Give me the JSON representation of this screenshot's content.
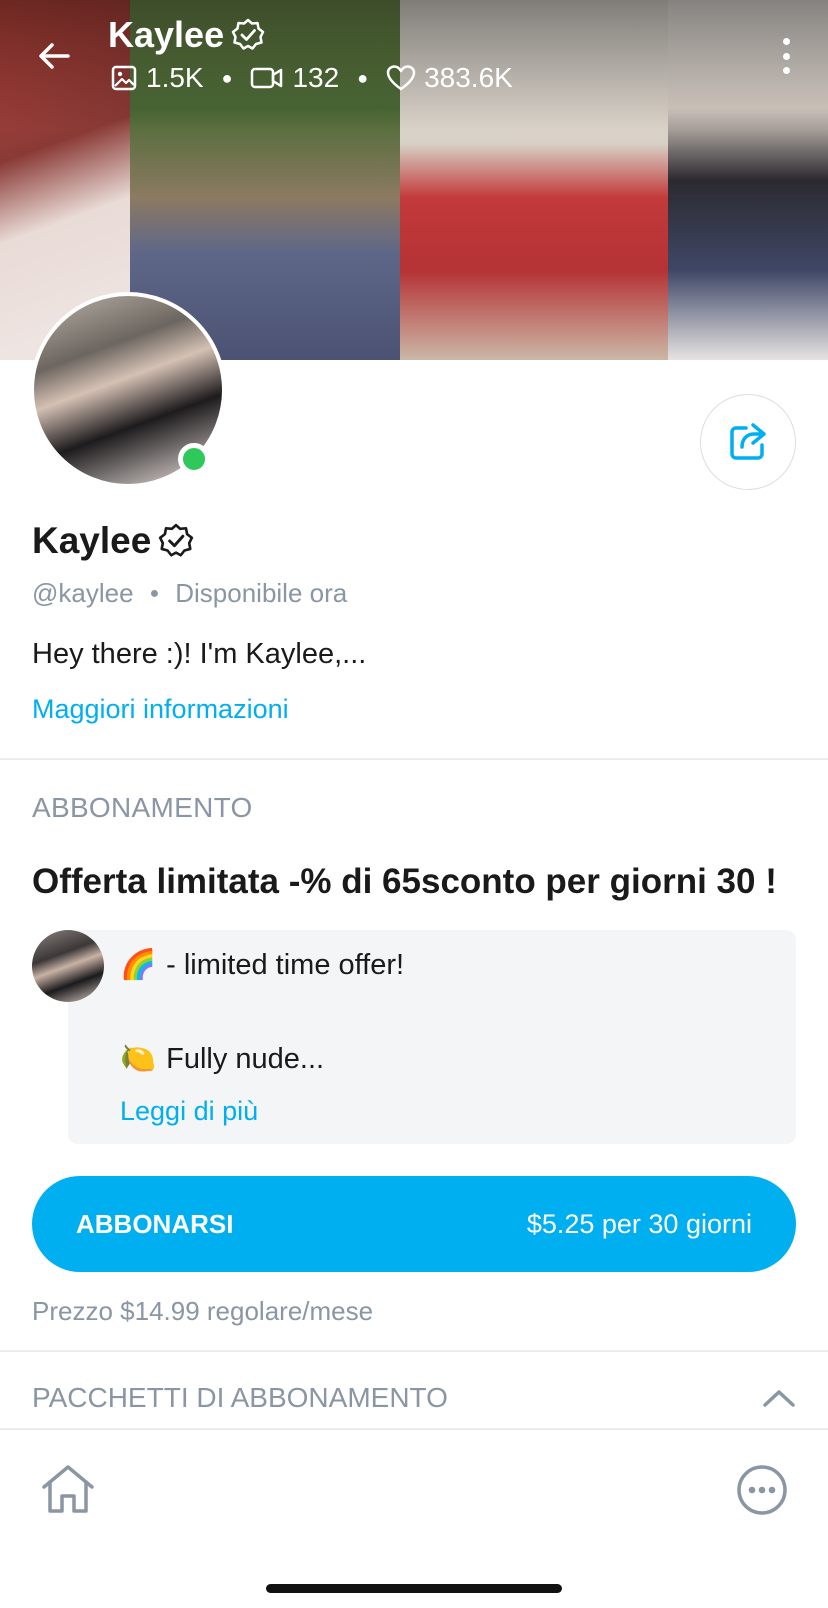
{
  "header": {
    "name": "Kaylee",
    "stats": {
      "photos": "1.5K",
      "videos": "132",
      "likes": "383.6K"
    }
  },
  "profile": {
    "name": "Kaylee",
    "handle": "@kaylee",
    "status": "Disponibile ora",
    "bio": "Hey there :)! I'm Kaylee,...",
    "more_info": "Maggiori informazioni",
    "online": true
  },
  "subscription": {
    "section_label": "ABBONAMENTO",
    "offer_title": "Offerta limitata -% di 65sconto per giorni 30 !",
    "message": {
      "line1_emoji": "🌈",
      "line1_text": "- limited time offer!",
      "line2_emoji": "🍋",
      "line2_text": "Fully nude...",
      "read_more": "Leggi di più"
    },
    "button_label": "ABBONARSI",
    "button_price": "$5.25 per 30 giorni",
    "regular_price": "Prezzo $14.99 regolare/mese"
  },
  "bundles": {
    "section_label": "PACCHETTI DI ABBONAMENTO"
  },
  "colors": {
    "accent": "#00aff0",
    "muted": "#8a96a3",
    "online": "#2ec85b"
  },
  "icons": {
    "back": "arrow-left-icon",
    "verified": "verified-badge-icon",
    "photos": "image-icon",
    "videos": "video-camera-icon",
    "likes": "heart-icon",
    "more": "vertical-dots-icon",
    "share": "share-icon",
    "collapse": "chevron-up-icon",
    "home": "home-icon",
    "more_nav": "more-circle-icon"
  }
}
